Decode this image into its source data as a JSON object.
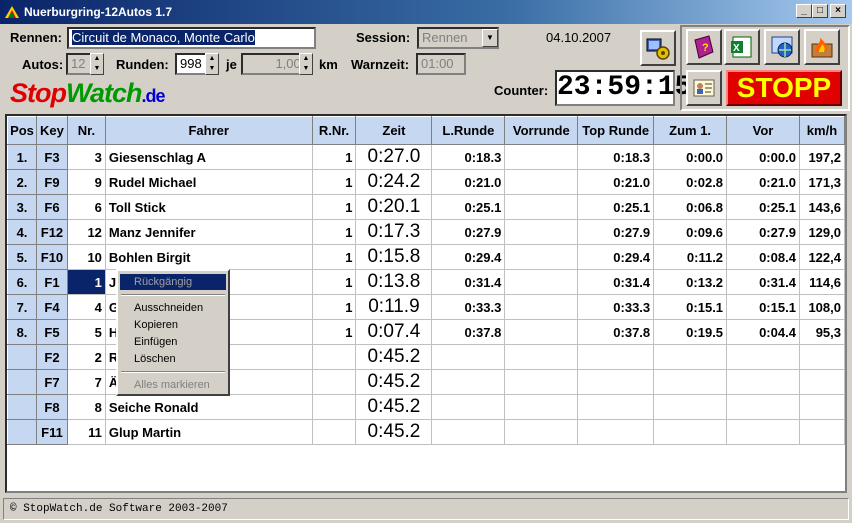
{
  "window": {
    "title": "Nuerburgring-12Autos 1.7"
  },
  "form": {
    "rennen_label": "Rennen:",
    "rennen_value": "Circuit de Monaco, Monte Carlo",
    "session_label": "Session:",
    "session_value": "Rennen",
    "date": "04.10.2007",
    "autos_label": "Autos:",
    "autos_value": "12",
    "runden_label": "Runden:",
    "runden_value": "998",
    "je_label": "je",
    "je_value": "1,000",
    "km_label": "km",
    "warnzeit_label": "Warnzeit:",
    "warnzeit_value": "01:00",
    "counter_label": "Counter:",
    "counter_value": "23:59:15",
    "stopp_label": "STOPP"
  },
  "logo": {
    "part1": "Stop",
    "part2": "Watch",
    "part3": ".de"
  },
  "table": {
    "headers": [
      "Pos",
      "Key",
      "Nr.",
      "Fahrer",
      "R.Nr.",
      "Zeit",
      "L.Runde",
      "Vorrunde",
      "Top Runde",
      "Zum 1.",
      "Vor",
      "km/h"
    ],
    "rows": [
      {
        "pos": "1.",
        "key": "F3",
        "nr": "3",
        "fahrer": "Giesenschlag A",
        "rnr": "1",
        "zeit": "0:27.0",
        "lrunde": "0:18.3",
        "vorrunde": "",
        "top": "0:18.3",
        "zum1": "0:00.0",
        "vor": "0:00.0",
        "kmh": "197,2"
      },
      {
        "pos": "2.",
        "key": "F9",
        "nr": "9",
        "fahrer": "Rudel Michael",
        "rnr": "1",
        "zeit": "0:24.2",
        "lrunde": "0:21.0",
        "vorrunde": "",
        "top": "0:21.0",
        "zum1": "0:02.8",
        "vor": "0:21.0",
        "kmh": "171,3"
      },
      {
        "pos": "3.",
        "key": "F6",
        "nr": "6",
        "fahrer": "Toll Stick",
        "rnr": "1",
        "zeit": "0:20.1",
        "lrunde": "0:25.1",
        "vorrunde": "",
        "top": "0:25.1",
        "zum1": "0:06.8",
        "vor": "0:25.1",
        "kmh": "143,6"
      },
      {
        "pos": "4.",
        "key": "F12",
        "nr": "12",
        "fahrer": "Manz Jennifer",
        "rnr": "1",
        "zeit": "0:17.3",
        "lrunde": "0:27.9",
        "vorrunde": "",
        "top": "0:27.9",
        "zum1": "0:09.6",
        "vor": "0:27.9",
        "kmh": "129,0"
      },
      {
        "pos": "5.",
        "key": "F10",
        "nr": "10",
        "fahrer": "Bohlen Birgit",
        "rnr": "1",
        "zeit": "0:15.8",
        "lrunde": "0:29.4",
        "vorrunde": "",
        "top": "0:29.4",
        "zum1": "0:11.2",
        "vor": "0:08.4",
        "kmh": "122,4"
      },
      {
        "pos": "6.",
        "key": "F1",
        "nr": "1",
        "fahrer": "J",
        "rnr": "1",
        "zeit": "0:13.8",
        "lrunde": "0:31.4",
        "vorrunde": "",
        "top": "0:31.4",
        "zum1": "0:13.2",
        "vor": "0:31.4",
        "kmh": "114,6"
      },
      {
        "pos": "7.",
        "key": "F4",
        "nr": "4",
        "fahrer": "G",
        "rnr": "1",
        "zeit": "0:11.9",
        "lrunde": "0:33.3",
        "vorrunde": "",
        "top": "0:33.3",
        "zum1": "0:15.1",
        "vor": "0:15.1",
        "kmh": "108,0"
      },
      {
        "pos": "8.",
        "key": "F5",
        "nr": "5",
        "fahrer": "H",
        "rnr": "1",
        "zeit": "0:07.4",
        "lrunde": "0:37.8",
        "vorrunde": "",
        "top": "0:37.8",
        "zum1": "0:19.5",
        "vor": "0:04.4",
        "kmh": "95,3"
      },
      {
        "pos": "",
        "key": "F2",
        "nr": "2",
        "fahrer": "R",
        "rnr": "",
        "zeit": "0:45.2",
        "lrunde": "",
        "vorrunde": "",
        "top": "",
        "zum1": "",
        "vor": "",
        "kmh": ""
      },
      {
        "pos": "",
        "key": "F7",
        "nr": "7",
        "fahrer": "Ä",
        "rnr": "",
        "zeit": "0:45.2",
        "lrunde": "",
        "vorrunde": "",
        "top": "",
        "zum1": "",
        "vor": "",
        "kmh": ""
      },
      {
        "pos": "",
        "key": "F8",
        "nr": "8",
        "fahrer": "Seiche Ronald",
        "rnr": "",
        "zeit": "0:45.2",
        "lrunde": "",
        "vorrunde": "",
        "top": "",
        "zum1": "",
        "vor": "",
        "kmh": ""
      },
      {
        "pos": "",
        "key": "F11",
        "nr": "11",
        "fahrer": "Glup Martin",
        "rnr": "",
        "zeit": "0:45.2",
        "lrunde": "",
        "vorrunde": "",
        "top": "",
        "zum1": "",
        "vor": "",
        "kmh": ""
      }
    ]
  },
  "context_menu": {
    "undo": "Rückgängig",
    "cut": "Ausschneiden",
    "copy": "Kopieren",
    "paste": "Einfügen",
    "delete": "Löschen",
    "select_all": "Alles markieren"
  },
  "status": {
    "text": "© StopWatch.de Software 2003-2007"
  },
  "colors": {
    "title_start": "#0a246a",
    "header_bg": "#c6d7f2",
    "stopp_bg": "#e00000",
    "stopp_text": "#ffff00",
    "logo_red": "#e00000",
    "logo_green": "#009a00",
    "logo_blue": "#0000d0"
  },
  "icons": [
    "settings-gear-icon",
    "help-book-icon",
    "excel-icon",
    "web-export-icon",
    "fire-icon",
    "driver-card-icon"
  ]
}
